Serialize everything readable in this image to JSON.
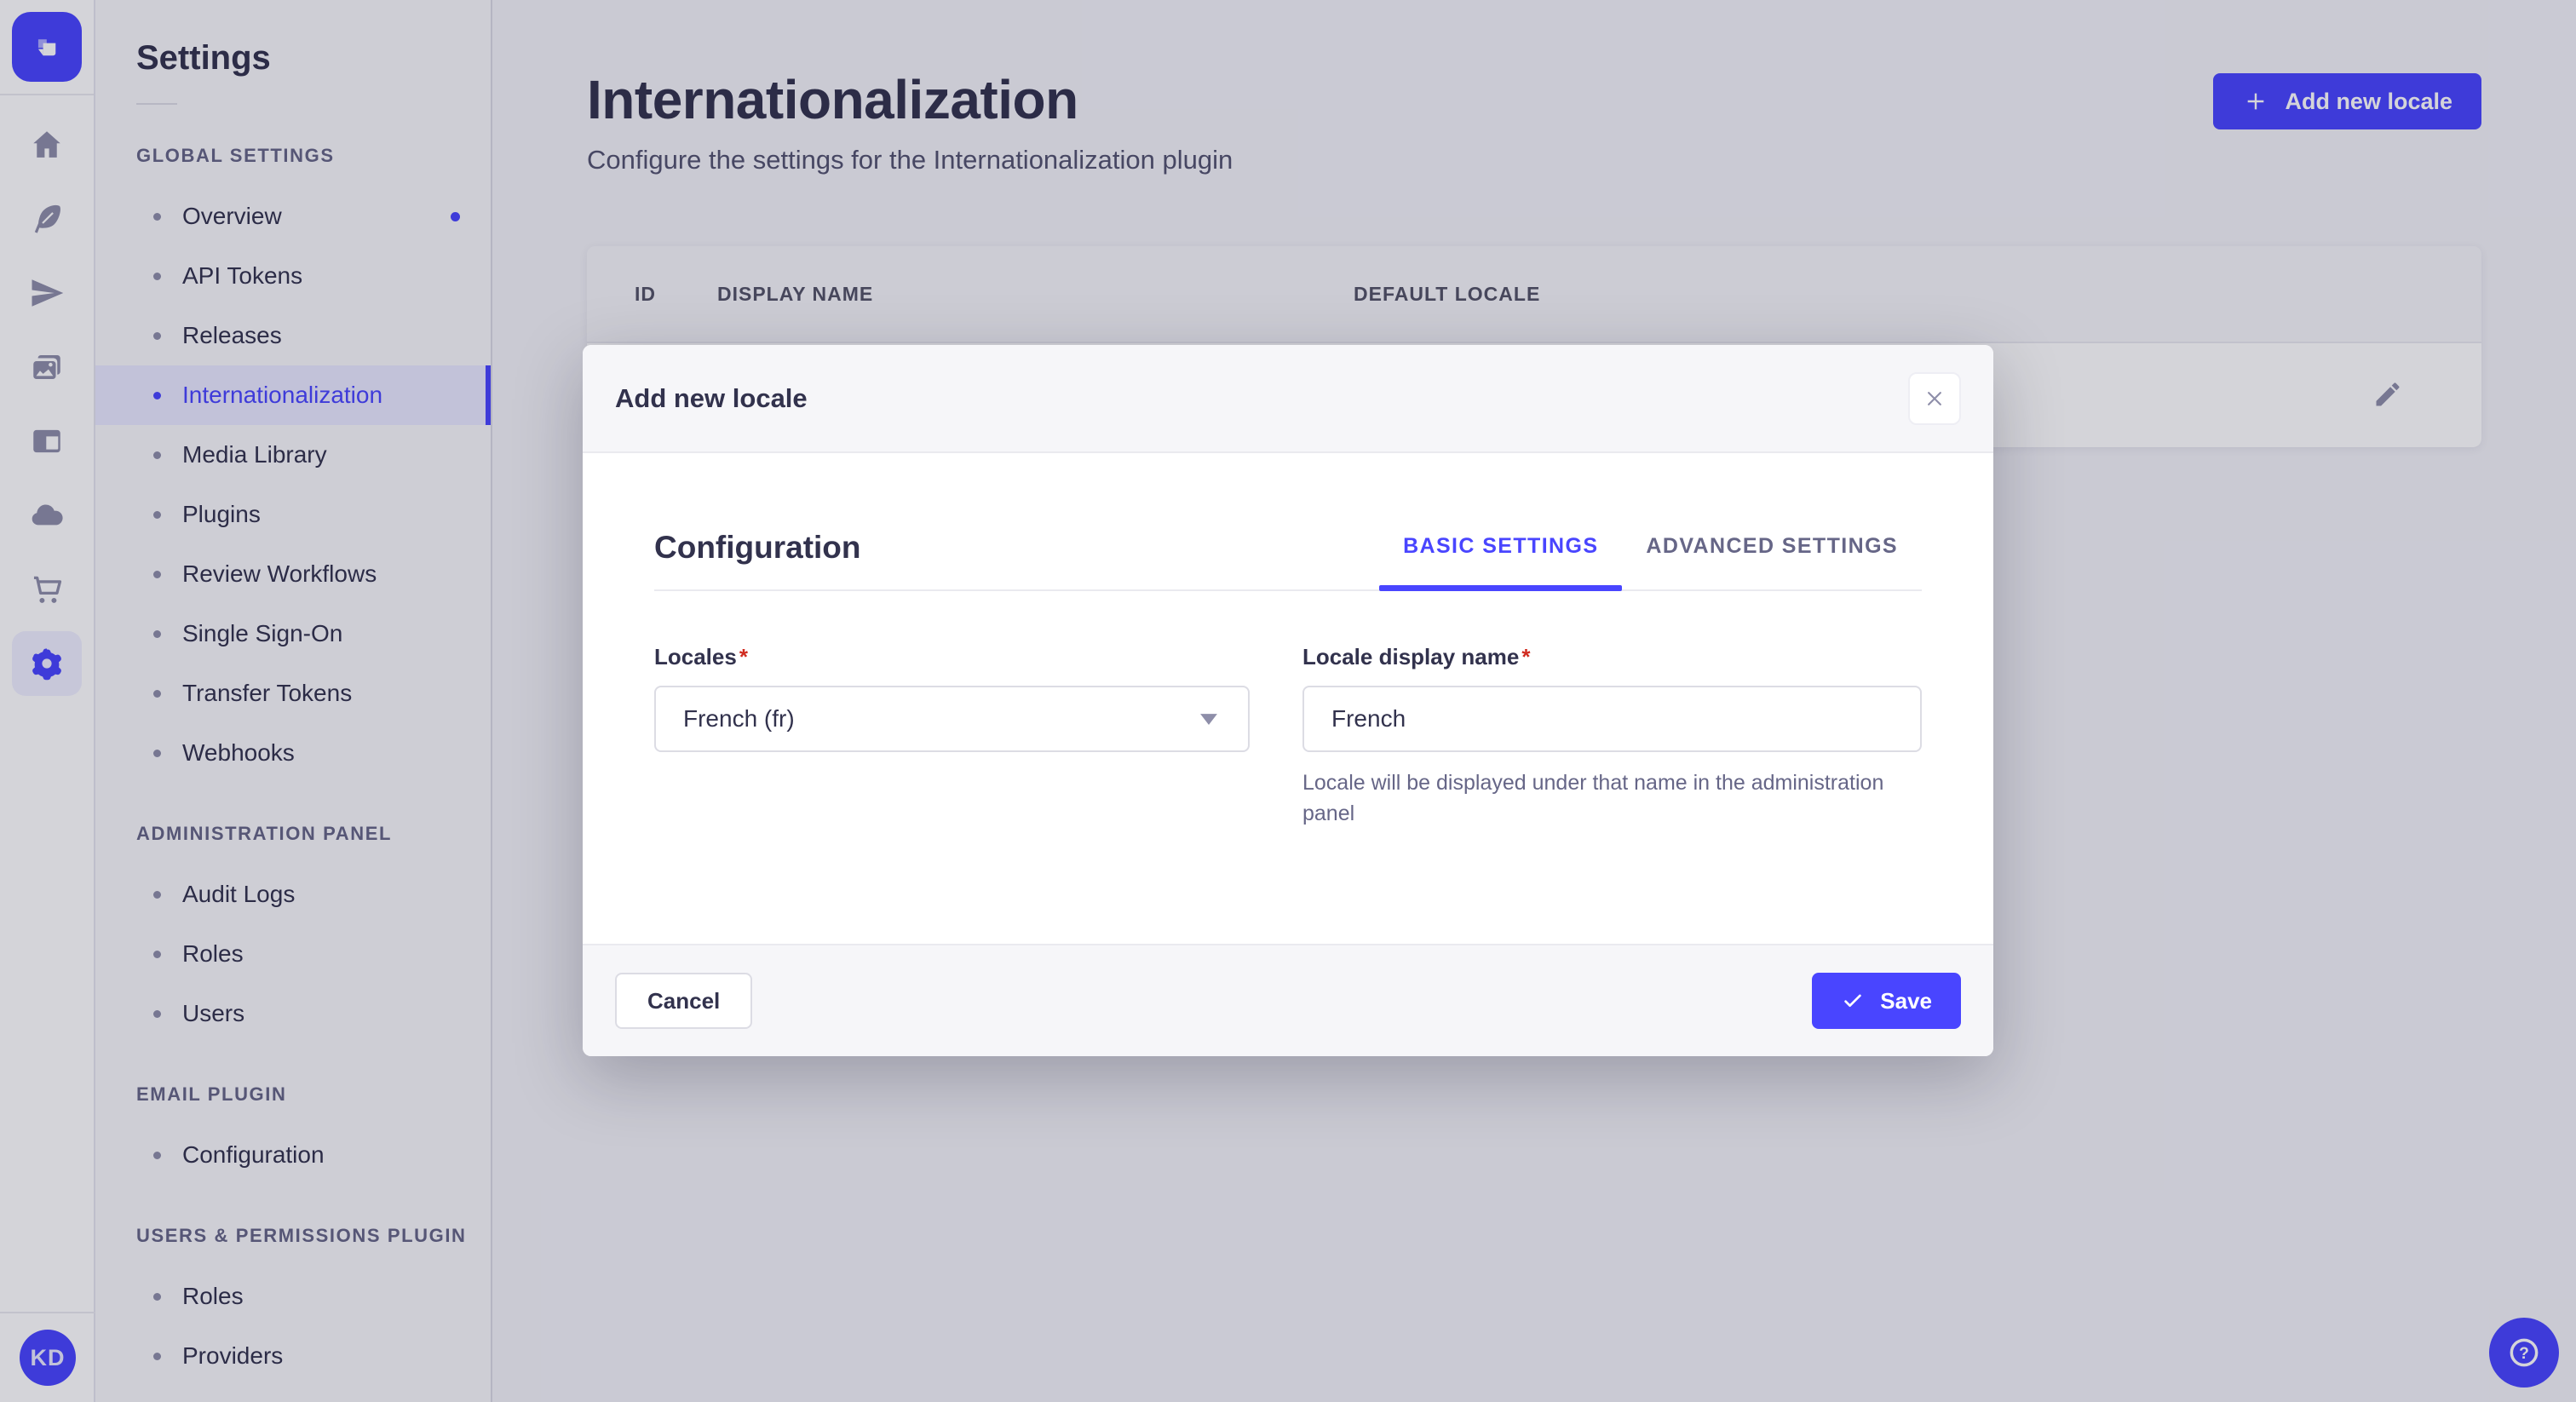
{
  "colors": {
    "accent": "#4945ff",
    "accent_light_bg": "#f0f0ff",
    "danger": "#d02b20",
    "text_dark": "#32324d",
    "text_muted": "#666687",
    "icon_gray": "#8e8ea9"
  },
  "rail": {
    "logo_icon": "strapi-logo",
    "icons": [
      "home-icon",
      "feather-icon",
      "paper-plane-icon",
      "media-library-icon",
      "layout-icon",
      "cloud-icon",
      "cart-icon",
      "settings-gear-icon"
    ],
    "active_icon": "settings-gear-icon",
    "avatar_initials": "KD"
  },
  "sidebar": {
    "title": "Settings",
    "sections": [
      {
        "label": "Global settings",
        "items": [
          {
            "label": "Overview",
            "has_notification": true
          },
          {
            "label": "API Tokens"
          },
          {
            "label": "Releases"
          },
          {
            "label": "Internationalization",
            "active": true
          },
          {
            "label": "Media Library"
          },
          {
            "label": "Plugins"
          },
          {
            "label": "Review Workflows"
          },
          {
            "label": "Single Sign-On"
          },
          {
            "label": "Transfer Tokens"
          },
          {
            "label": "Webhooks"
          }
        ]
      },
      {
        "label": "Administration panel",
        "items": [
          {
            "label": "Audit Logs"
          },
          {
            "label": "Roles"
          },
          {
            "label": "Users"
          }
        ]
      },
      {
        "label": "Email plugin",
        "items": [
          {
            "label": "Configuration"
          }
        ]
      },
      {
        "label": "Users & Permissions plugin",
        "items": [
          {
            "label": "Roles"
          },
          {
            "label": "Providers"
          }
        ]
      }
    ]
  },
  "page": {
    "title": "Internationalization",
    "subtitle": "Configure the settings for the Internationalization plugin",
    "add_button_label": "Add new locale"
  },
  "table": {
    "columns": [
      "ID",
      "DISPLAY NAME",
      "DEFAULT LOCALE"
    ],
    "row_action_icon": "pencil-icon"
  },
  "modal": {
    "title": "Add new locale",
    "close_icon": "close-icon",
    "section_title": "Configuration",
    "required_mark": "*",
    "tabs": [
      {
        "label": "Basic settings",
        "active": true
      },
      {
        "label": "Advanced settings",
        "active": false
      }
    ],
    "fields": {
      "locales": {
        "label": "Locales",
        "required": true,
        "value": "French (fr)"
      },
      "display_name": {
        "label": "Locale display name",
        "required": true,
        "value": "French",
        "help": "Locale will be displayed under that name in the administration panel"
      }
    },
    "footer": {
      "cancel_label": "Cancel",
      "save_label": "Save",
      "save_icon": "check-icon"
    }
  },
  "help_button_icon": "question-mark-icon"
}
